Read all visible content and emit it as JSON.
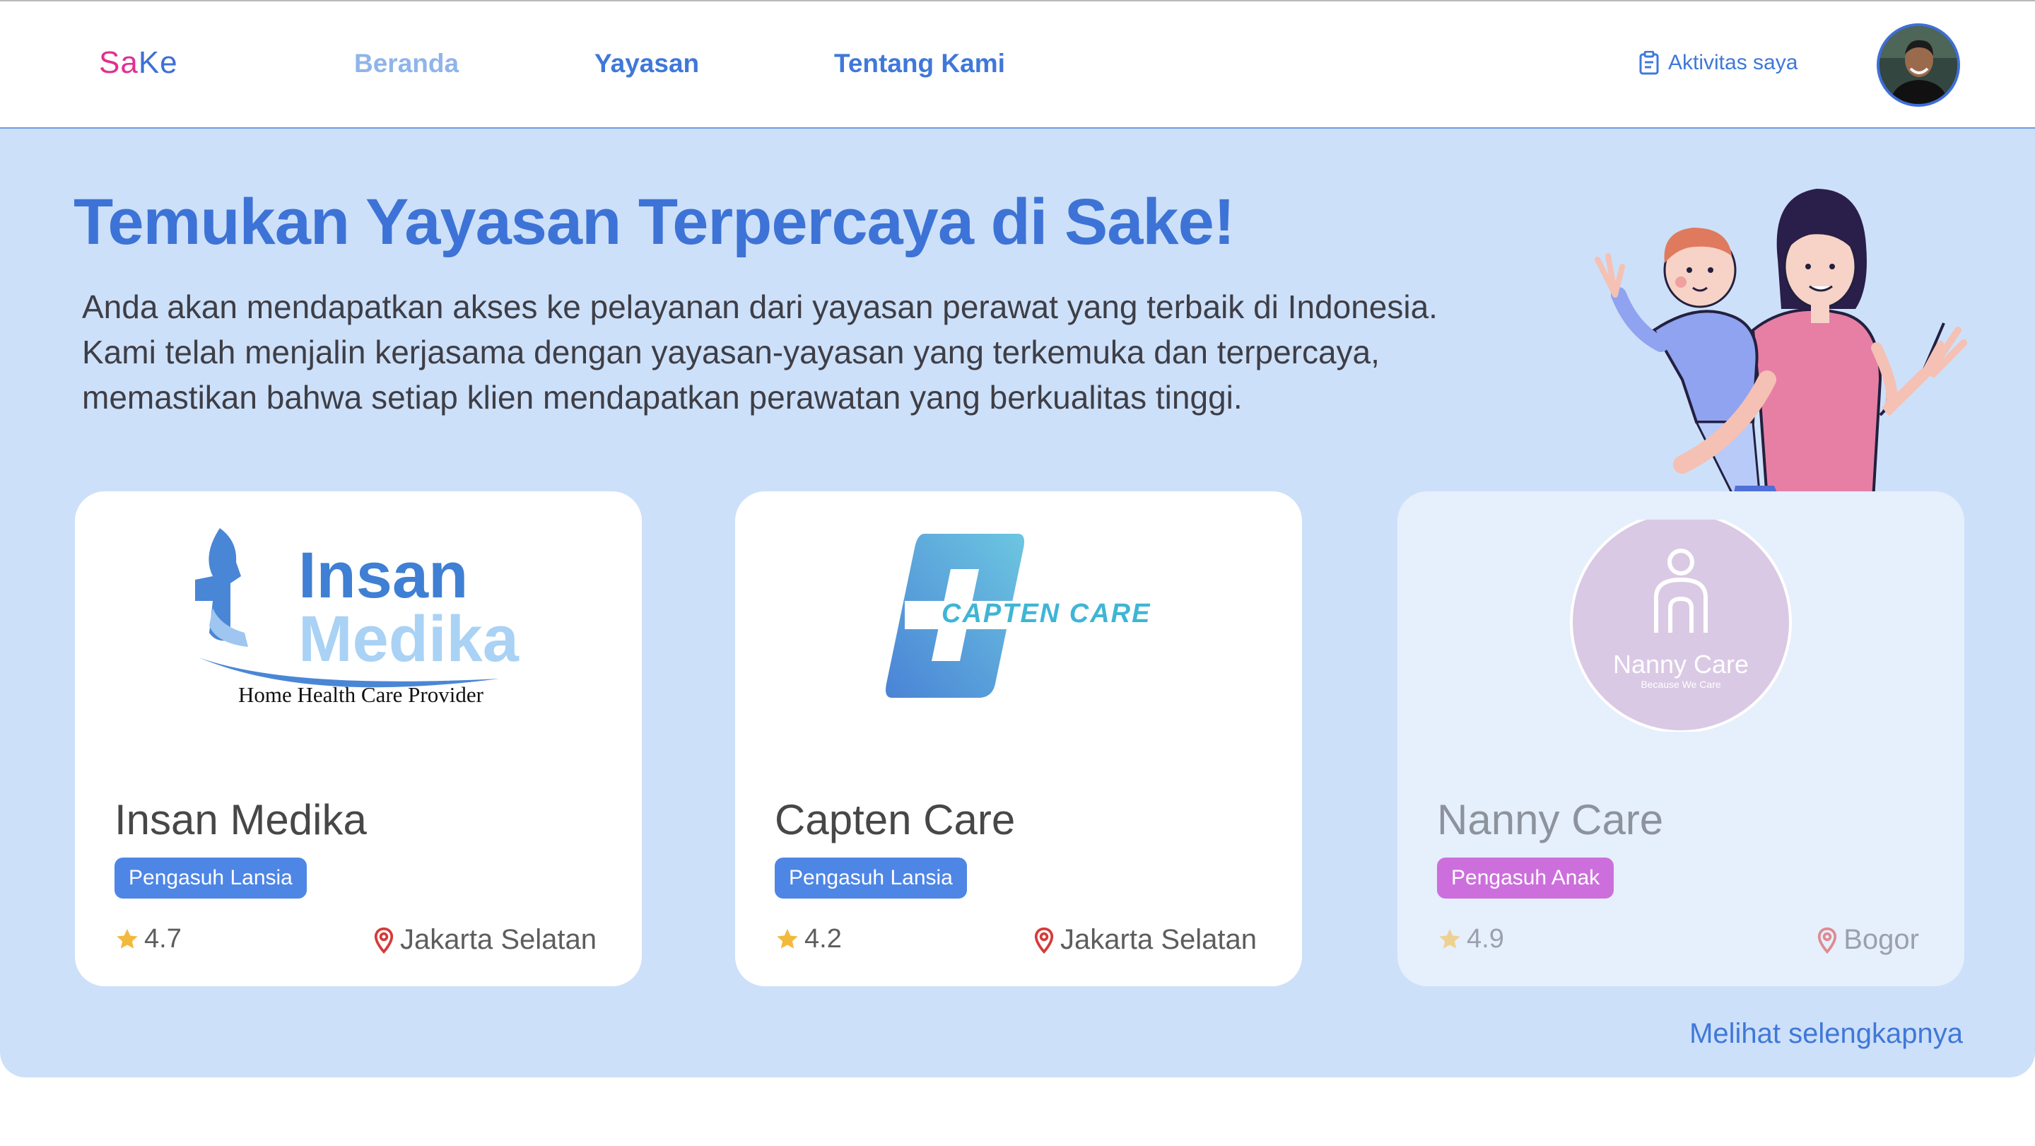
{
  "nav": {
    "logo_part1": "Sa",
    "logo_part2": "Ke",
    "links": [
      "Beranda",
      "Yayasan",
      "Tentang Kami"
    ],
    "active_link": "Beranda",
    "activity_label": "Aktivitas saya"
  },
  "hero": {
    "title": "Temukan Yayasan Terpercaya di Sake!",
    "lines": [
      "Anda akan mendapatkan akses ke pelayanan dari yayasan perawat yang  terbaik di Indonesia.",
      "Kami telah menjalin kerjasama dengan  yayasan-yayasan yang terkemuka dan terpercaya,",
      "memastikan bahwa setiap  klien mendapatkan perawatan yang berkualitas tinggi."
    ]
  },
  "cards": [
    {
      "name": "Insan Medika",
      "category": "Pengasuh Lansia",
      "rating": "4.7",
      "location": "Jakarta Selatan",
      "logo_text": [
        "Insan",
        "Medika",
        "Home Health Care Provider"
      ]
    },
    {
      "name": "Capten Care",
      "category": "Pengasuh Lansia",
      "rating": "4.2",
      "location": "Jakarta Selatan",
      "logo_text": [
        "CAPTEN CARE"
      ]
    },
    {
      "name": "Nanny Care",
      "category": "Pengasuh Anak",
      "rating": "4.9",
      "location": "Bogor",
      "logo_text": [
        "Nanny Care",
        "Because We Care"
      ]
    }
  ],
  "see_more": "Melihat selengkapnya",
  "colors": {
    "accent": "#3f78d9",
    "hero_bg": "#cde0f9",
    "badge_blue": "#4e86e6",
    "badge_pink": "#cc6fdc",
    "logo_pink": "#e2308f"
  },
  "icons": [
    "clipboard-icon",
    "star-icon",
    "map-pin-icon"
  ]
}
